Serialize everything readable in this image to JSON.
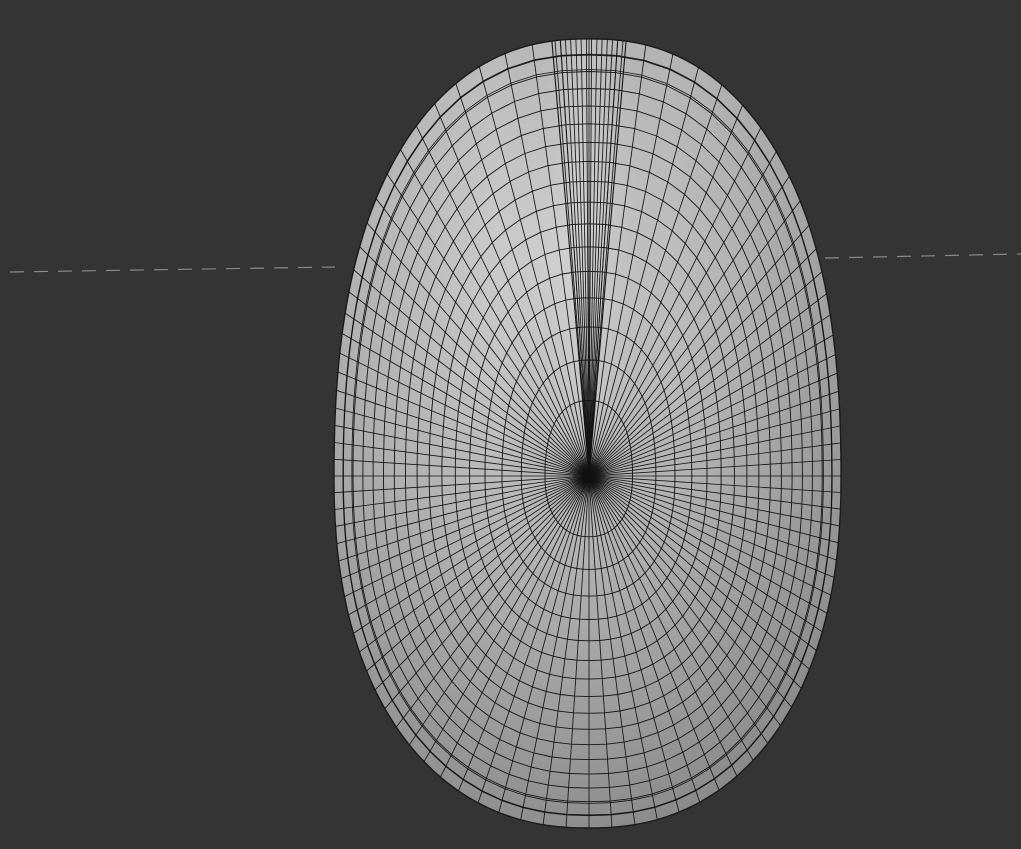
{
  "viewport": {
    "background": "#343434",
    "mode": "wireframe-on-shaded"
  },
  "mesh": {
    "name": "",
    "shading": {
      "highlight": "#cfcfcf",
      "mid": "#a9a9a9",
      "shadow": "#7a7a7a",
      "wire": "#141414"
    },
    "topology": {
      "radial_segments": 96,
      "loops": 16,
      "pole": "center"
    }
  },
  "horizon": {
    "style": "dashed",
    "color": "#8a8a8a"
  }
}
